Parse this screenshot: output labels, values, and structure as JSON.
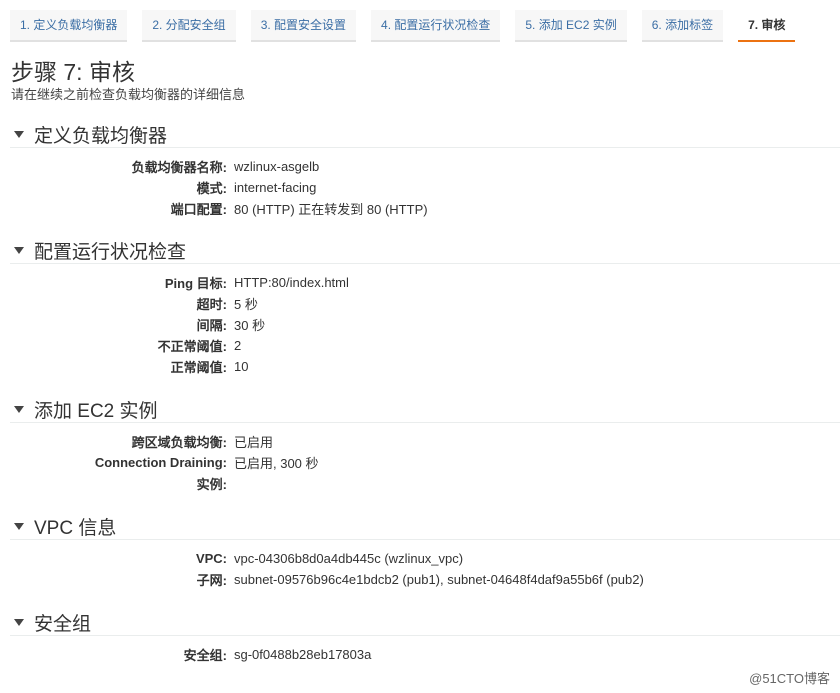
{
  "tabs": [
    {
      "label": "1. 定义负载均衡器",
      "active": false
    },
    {
      "label": "2. 分配安全组",
      "active": false
    },
    {
      "label": "3. 配置安全设置",
      "active": false
    },
    {
      "label": "4. 配置运行状况检查",
      "active": false
    },
    {
      "label": "5. 添加 EC2 实例",
      "active": false
    },
    {
      "label": "6. 添加标签",
      "active": false
    },
    {
      "label": "7. 审核",
      "active": true
    }
  ],
  "page": {
    "title": "步骤 7: 审核",
    "subtitle": "请在继续之前检查负载均衡器的详细信息"
  },
  "sections": {
    "lb": {
      "title": "定义负载均衡器",
      "rows": [
        {
          "label": "负载均衡器名称:",
          "value": "wzlinux-asgelb"
        },
        {
          "label": "模式:",
          "value": "internet-facing"
        },
        {
          "label": "端口配置:",
          "value": "80 (HTTP) 正在转发到 80 (HTTP)"
        }
      ]
    },
    "health": {
      "title": "配置运行状况检查",
      "rows": [
        {
          "label": "Ping 目标:",
          "value": "HTTP:80/index.html"
        },
        {
          "label": "超时:",
          "value": "5 秒"
        },
        {
          "label": "间隔:",
          "value": "30 秒"
        },
        {
          "label": "不正常阈值:",
          "value": "2"
        },
        {
          "label": "正常阈值:",
          "value": "10"
        }
      ]
    },
    "ec2": {
      "title": "添加 EC2 实例",
      "rows": [
        {
          "label": "跨区域负载均衡:",
          "value": "已启用"
        },
        {
          "label": "Connection Draining:",
          "value": "已启用, 300 秒"
        },
        {
          "label": "实例:",
          "value": ""
        }
      ]
    },
    "vpc": {
      "title": "VPC 信息",
      "rows": [
        {
          "label": "VPC:",
          "value": "vpc-04306b8d0a4db445c (wzlinux_vpc)"
        },
        {
          "label": "子网:",
          "value": "subnet-09576b96c4e1bdcb2 (pub1), subnet-04648f4daf9a55b6f (pub2)"
        }
      ]
    },
    "sg": {
      "title": "安全组",
      "rows": [
        {
          "label": "安全组:",
          "value": "sg-0f0488b28eb17803a"
        }
      ]
    }
  },
  "watermark": "@51CTO博客",
  "colors": {
    "link": "#3b6ea5",
    "active_tab_underline": "#ec7211"
  }
}
